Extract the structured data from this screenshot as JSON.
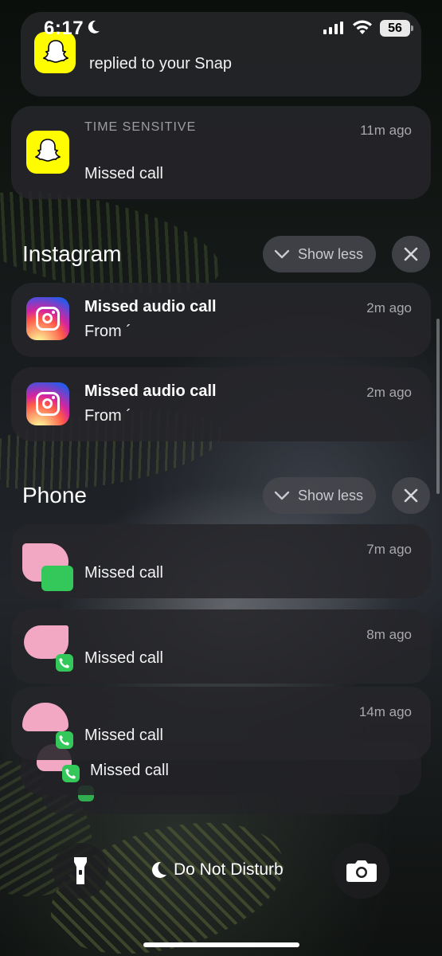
{
  "status_bar": {
    "time": "6:17",
    "battery": "56"
  },
  "snap_replied": {
    "body": "replied to your Snap"
  },
  "snap_missed": {
    "label": "TIME SENSITIVE",
    "time_ago": "11m ago",
    "body": "Missed call"
  },
  "instagram_group": {
    "header": "Instagram",
    "show_less": "Show less",
    "notifications": [
      {
        "title": "Missed audio call",
        "body": "From ´",
        "time_ago": "2m ago"
      },
      {
        "title": "Missed audio call",
        "body": "From ´",
        "time_ago": "2m ago"
      }
    ]
  },
  "phone_group": {
    "header": "Phone",
    "show_less": "Show less",
    "notifications": [
      {
        "body": "Missed call",
        "time_ago": "7m ago"
      },
      {
        "body": "Missed call",
        "time_ago": "8m ago"
      },
      {
        "body": "Missed call",
        "time_ago": "14m ago"
      },
      {
        "body": "Missed call"
      }
    ]
  },
  "bottom": {
    "dnd_label": "Do Not Disturb"
  },
  "icons": [
    "moon-icon",
    "signal-icon",
    "wifi-icon",
    "battery-icon",
    "snapchat-icon",
    "instagram-icon",
    "chevron-down-icon",
    "close-icon",
    "phone-icon",
    "flashlight-icon",
    "camera-icon"
  ],
  "colors": {
    "snapchat": "#fffc00",
    "phone_green": "#34c759",
    "avatar_pink": "#f2a7c3"
  }
}
